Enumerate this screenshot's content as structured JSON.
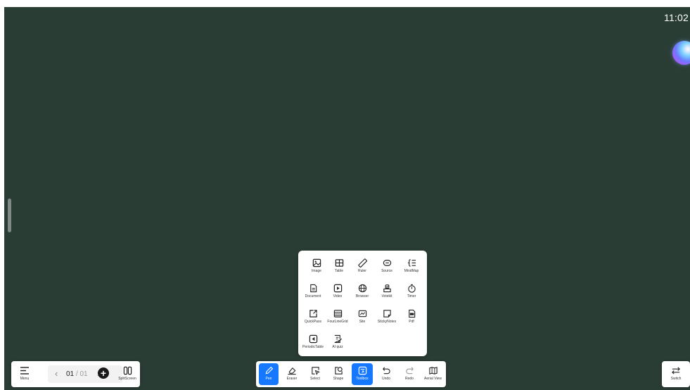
{
  "status": {
    "clock": "11:02"
  },
  "toolbox": {
    "items": [
      {
        "label": "Image",
        "icon": "image-icon"
      },
      {
        "label": "Table",
        "icon": "table-icon"
      },
      {
        "label": "Ruler",
        "icon": "ruler-icon"
      },
      {
        "label": "Source",
        "icon": "source-icon"
      },
      {
        "label": "MindMap",
        "icon": "mindmap-icon"
      },
      {
        "label": "Document",
        "icon": "document-icon"
      },
      {
        "label": "Video",
        "icon": "video-icon"
      },
      {
        "label": "Browser",
        "icon": "browser-icon"
      },
      {
        "label": "Votekit",
        "icon": "votekit-icon"
      },
      {
        "label": "Timer",
        "icon": "timer-icon"
      },
      {
        "label": "QuickPass",
        "icon": "quickpass-icon"
      },
      {
        "label": "FourLineGrid",
        "icon": "four-line-grid-icon"
      },
      {
        "label": "Site",
        "icon": "site-icon"
      },
      {
        "label": "StickyNotes",
        "icon": "sticky-notes-icon"
      },
      {
        "label": "Pdf",
        "icon": "pdf-icon"
      },
      {
        "label": "PeriodicTable",
        "icon": "periodic-table-icon"
      },
      {
        "label": "AI quiz",
        "icon": "ai-quiz-icon"
      }
    ]
  },
  "left_bar": {
    "menu_label": "Menu",
    "page_current": "01",
    "page_separator": " / ",
    "page_total": "01",
    "prev_glyph": "‹",
    "next_glyph": "›",
    "add_glyph": "+",
    "split_label": "SplitScreen"
  },
  "center_bar": {
    "items": [
      {
        "label": "Pen",
        "icon": "pen-icon",
        "active": true
      },
      {
        "label": "Eraser",
        "icon": "eraser-icon",
        "active": false
      },
      {
        "label": "Select",
        "icon": "select-icon",
        "active": false
      },
      {
        "label": "Shape",
        "icon": "shape-icon",
        "active": false
      },
      {
        "label": "Toolbox",
        "icon": "toolbox-icon",
        "active": true
      },
      {
        "label": "Undo",
        "icon": "undo-icon",
        "active": false
      },
      {
        "label": "Redo",
        "icon": "redo-icon",
        "active": false
      },
      {
        "label": "Aerial View",
        "icon": "aerial-view-icon",
        "active": false
      }
    ]
  },
  "right_bar": {
    "switch_label": "Switch"
  },
  "colors": {
    "board": "#2a3d35",
    "accent": "#1677ff",
    "panel": "#ffffff"
  }
}
